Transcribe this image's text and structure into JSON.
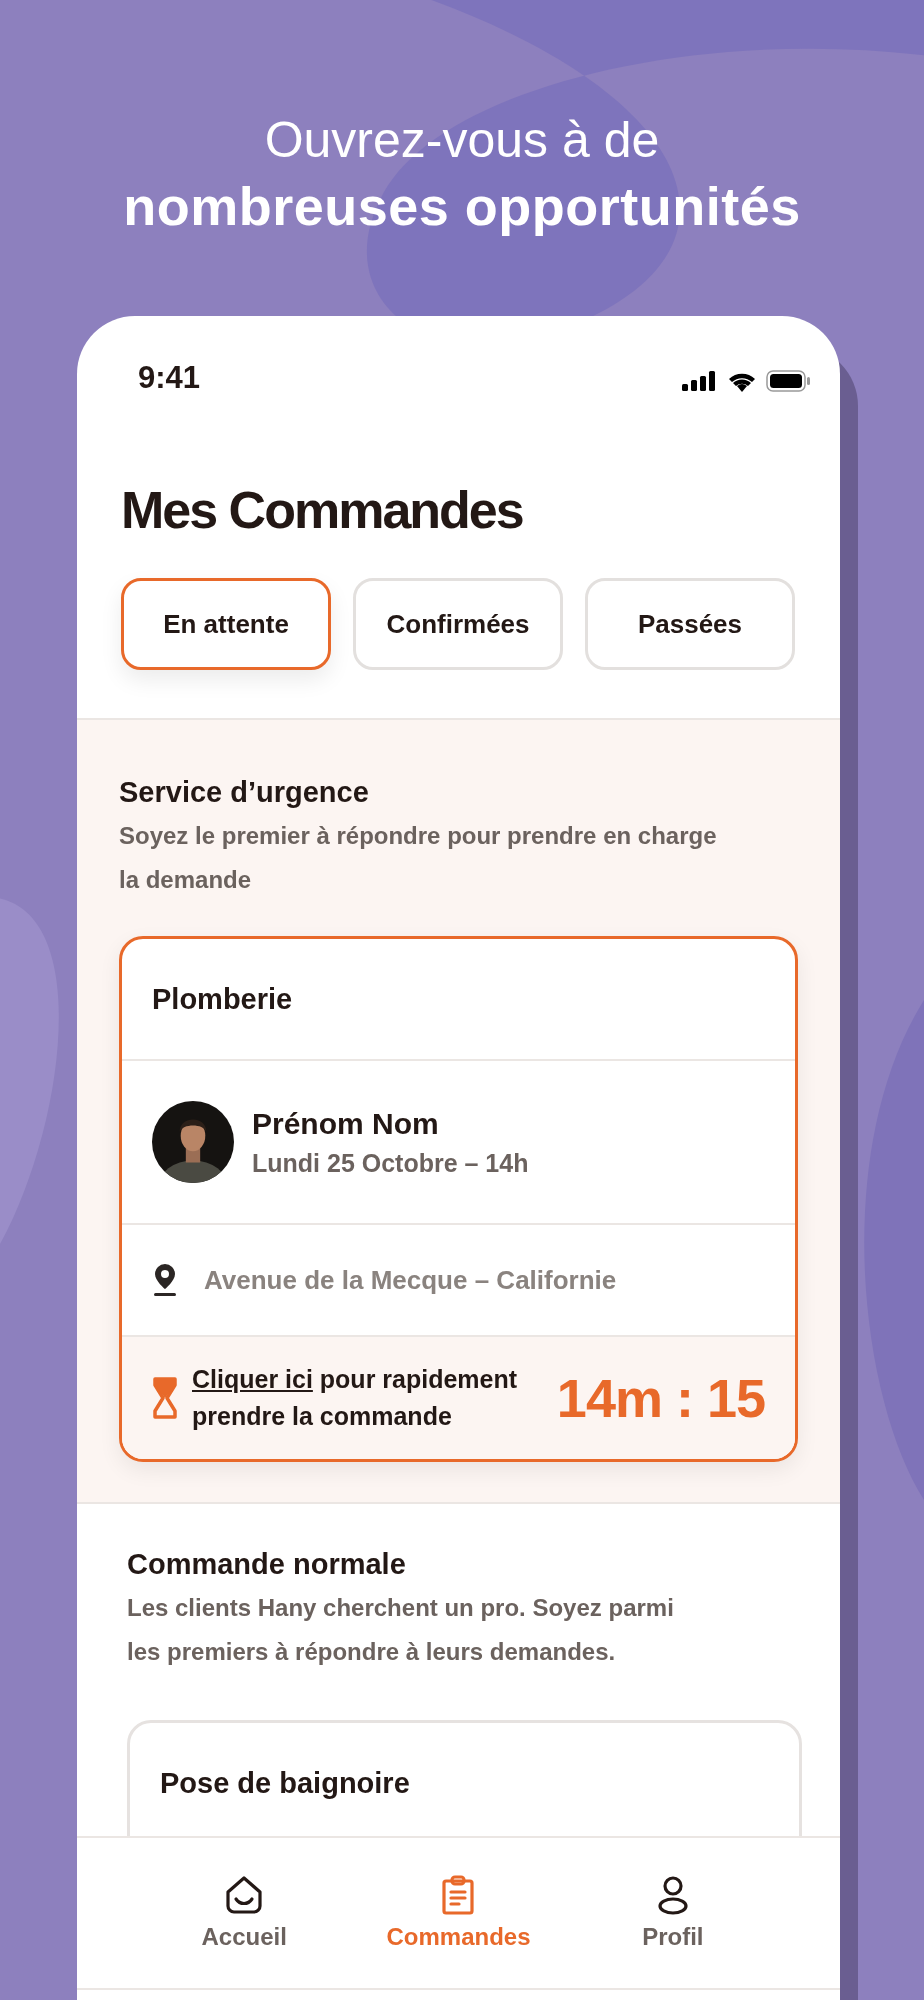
{
  "headline": "Ouvrez-vous à de **nombreuses opportunités**",
  "status_bar": {
    "time": "9:41"
  },
  "title": "Mes Commandes",
  "tabs": [
    {
      "label": "En attente",
      "selected": true
    },
    {
      "label": "Confirmées",
      "selected": false
    },
    {
      "label": "Passées",
      "selected": false
    }
  ],
  "urgent": {
    "title": "Service d’urgence",
    "subtitle": "Soyez le premier à répondre pour prendre en charge la demande",
    "card": {
      "category": "Plomberie",
      "name": "Prénom Nom",
      "date": "Lundi 25 Octobre – 14h",
      "address": "Avenue de la Mecque – Californie",
      "link": "Cliquer ici",
      "action_text": "pour rapidement prendre la commande",
      "timer": "14m : 15"
    }
  },
  "normal": {
    "title": "Commande normale",
    "subtitle": "Les clients Hany cherchent un pro. Soyez parmi les premiers à répondre à leurs demandes.",
    "cards": [
      {
        "category": "Pose de baignoire"
      }
    ]
  },
  "nav": [
    {
      "kind": "home",
      "label": "Accueil",
      "selected": false
    },
    {
      "kind": "orders",
      "label": "Commandes",
      "selected": true
    },
    {
      "kind": "profile",
      "label": "Profil",
      "selected": false
    }
  ]
}
